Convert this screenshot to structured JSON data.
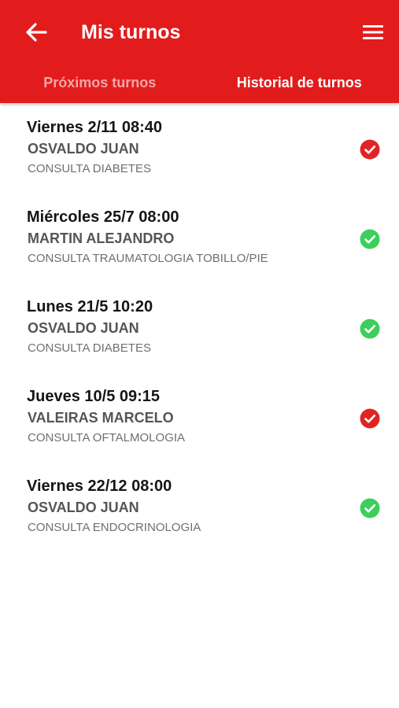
{
  "header": {
    "title": "Mis turnos",
    "back_icon": "arrow-left-icon",
    "menu_icon": "hamburger-menu-icon",
    "color": "#e21c1c"
  },
  "tabs": [
    {
      "label": "Próximos turnos",
      "active": false
    },
    {
      "label": "Historial de turnos",
      "active": true
    }
  ],
  "appointments": [
    {
      "date": "Viernes 2/11 08:40",
      "doctor": "OSVALDO JUAN",
      "specialty": "CONSULTA DIABETES",
      "status_icon": "check-circle-icon",
      "status_color": "#e02424"
    },
    {
      "date": "Miércoles 25/7 08:00",
      "doctor": "MARTIN ALEJANDRO",
      "specialty": "CONSULTA TRAUMATOLOGIA TOBILLO/PIE",
      "status_icon": "check-circle-icon",
      "status_color": "#3ccf5c"
    },
    {
      "date": "Lunes 21/5 10:20",
      "doctor": "OSVALDO JUAN",
      "specialty": "CONSULTA DIABETES",
      "status_icon": "check-circle-icon",
      "status_color": "#3ccf5c"
    },
    {
      "date": "Jueves 10/5 09:15",
      "doctor": "VALEIRAS MARCELO",
      "specialty": "CONSULTA OFTALMOLOGIA",
      "status_icon": "check-circle-icon",
      "status_color": "#e02424"
    },
    {
      "date": "Viernes 22/12 08:00",
      "doctor": "OSVALDO JUAN",
      "specialty": "CONSULTA ENDOCRINOLOGIA",
      "status_icon": "check-circle-icon",
      "status_color": "#3ccf5c"
    }
  ]
}
